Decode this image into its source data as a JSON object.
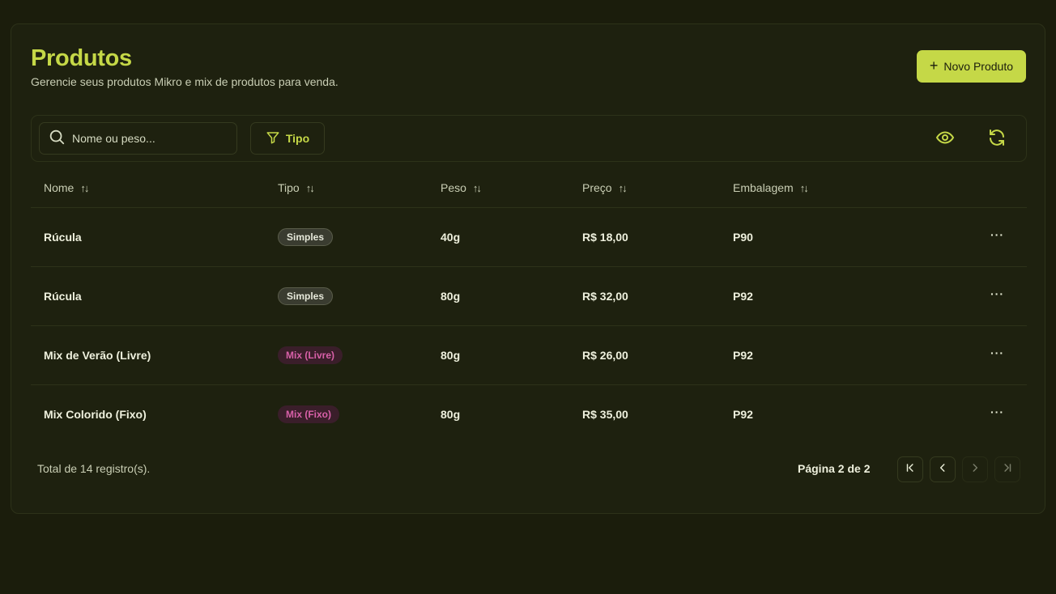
{
  "header": {
    "title": "Produtos",
    "subtitle": "Gerencie seus produtos Mikro e mix de produtos para venda.",
    "new_button_label": "Novo Produto",
    "new_button_icon": "plus-icon"
  },
  "toolbar": {
    "search": {
      "placeholder": "Nome ou peso...",
      "value": "",
      "icon": "search-icon"
    },
    "filter_label": "Tipo",
    "filter_icon": "filter-icon",
    "view_icon": "eye-icon",
    "refresh_icon": "refresh-icon"
  },
  "table": {
    "columns": [
      "Nome",
      "Tipo",
      "Peso",
      "Preço",
      "Embalagem"
    ],
    "sort_icon": "sort-arrows-icon",
    "rows": [
      {
        "nome": "Rúcula",
        "tipo": "Simples",
        "tipo_kind": "simple",
        "peso": "40g",
        "preco": "R$ 18,00",
        "embalagem": "P90",
        "actions": "···"
      },
      {
        "nome": "Rúcula",
        "tipo": "Simples",
        "tipo_kind": "simple",
        "peso": "80g",
        "preco": "R$ 32,00",
        "embalagem": "P92",
        "actions": "···"
      },
      {
        "nome": "Mix de Verão (Livre)",
        "tipo": "Mix (Livre)",
        "tipo_kind": "mix",
        "peso": "80g",
        "preco": "R$ 26,00",
        "embalagem": "P92",
        "actions": "···"
      },
      {
        "nome": "Mix Colorido (Fixo)",
        "tipo": "Mix (Fixo)",
        "tipo_kind": "mix",
        "peso": "80g",
        "preco": "R$ 35,00",
        "embalagem": "P92",
        "actions": "···"
      }
    ]
  },
  "footer": {
    "total": "Total de 14 registro(s).",
    "page_info": "Página 2 de 2",
    "current_page": 2,
    "total_pages": 2
  },
  "colors": {
    "accent": "#c5d847",
    "background": "#1b1d0c",
    "mix_badge": "#d860a8"
  }
}
